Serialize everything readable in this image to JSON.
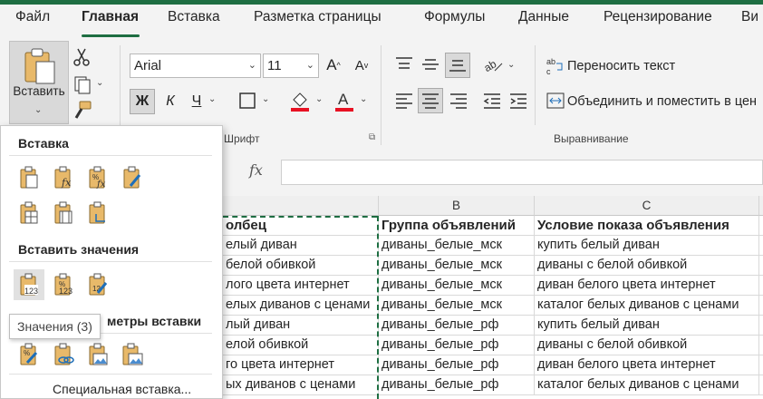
{
  "tabs": [
    "Файл",
    "Главная",
    "Вставка",
    "Разметка страницы",
    "Формулы",
    "Данные",
    "Рецензирование",
    "Ви"
  ],
  "ribbon": {
    "paste_label": "Вставить",
    "font_name": "Arial",
    "font_size": "11",
    "bold": "Ж",
    "italic": "К",
    "underline": "Ч",
    "font_group": "Шрифт",
    "wrap_text": "Переносить текст",
    "merge": "Объединить и поместить в цен",
    "align_group": "Выравнивание",
    "font_color": "#e81123",
    "fill_color": "#e81123"
  },
  "formula_bar": {
    "fx": "fx",
    "value": ""
  },
  "columns": [
    {
      "label": ""
    },
    {
      "label": "B"
    },
    {
      "label": "C"
    }
  ],
  "rows": [
    [
      "олбец",
      "Группа объявлений",
      "Условие показа объявления"
    ],
    [
      "елый диван",
      "диваны_белые_мск",
      "купить белый диван"
    ],
    [
      "белой обивкой",
      "диваны_белые_мск",
      "диваны с белой обивкой"
    ],
    [
      "лого цвета интернет",
      "диваны_белые_мск",
      "диван белого цвета интернет"
    ],
    [
      "елых диванов с ценами",
      "диваны_белые_мск",
      "каталог белых диванов с ценами"
    ],
    [
      "лый диван",
      "диваны_белые_рф",
      "купить белый диван"
    ],
    [
      "елой обивкой",
      "диваны_белые_рф",
      "диваны с белой обивкой"
    ],
    [
      "го цвета интернет",
      "диваны_белые_рф",
      "диван белого цвета интернет"
    ],
    [
      "ых диванов с ценами",
      "диваны_белые_рф",
      "каталог белых диванов с ценами"
    ]
  ],
  "popup": {
    "section_paste": "Вставка",
    "section_values": "Вставить значения",
    "section_other": "метры вставки",
    "special": "Специальная вставка...",
    "tooltip": "Значения (3)"
  },
  "accent": "#1e6e42"
}
